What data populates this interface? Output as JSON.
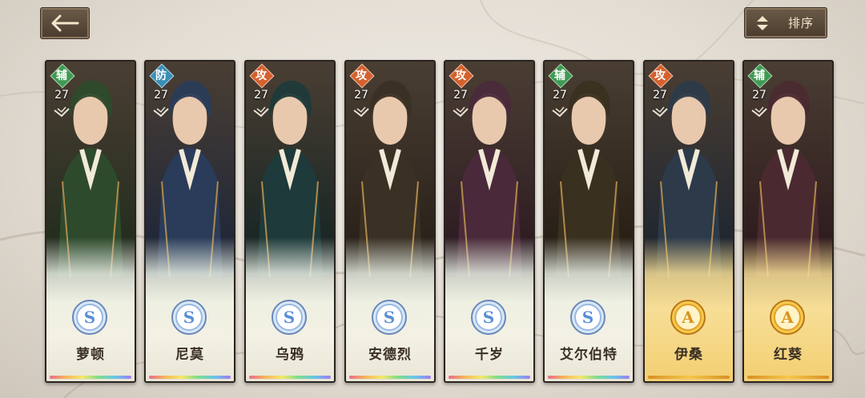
{
  "header": {
    "back_icon": "arrow-left-icon",
    "sort_icon": "sort-updown-icon",
    "sort_label": "排序"
  },
  "colors": {
    "support": "#3f9a52",
    "defense": "#3a8fb5",
    "attack": "#d4612e",
    "rank_s": "#5a8fd6",
    "rank_a": "#d9951e"
  },
  "cards": [
    {
      "role": "辅",
      "role_type": "support",
      "level": "27",
      "rank": "S",
      "name": "萝顿"
    },
    {
      "role": "防",
      "role_type": "defense",
      "level": "27",
      "rank": "S",
      "name": "尼莫"
    },
    {
      "role": "攻",
      "role_type": "attack",
      "level": "27",
      "rank": "S",
      "name": "乌鸦"
    },
    {
      "role": "攻",
      "role_type": "attack",
      "level": "27",
      "rank": "S",
      "name": "安德烈"
    },
    {
      "role": "攻",
      "role_type": "attack",
      "level": "27",
      "rank": "S",
      "name": "千岁"
    },
    {
      "role": "辅",
      "role_type": "support",
      "level": "27",
      "rank": "S",
      "name": "艾尔伯特"
    },
    {
      "role": "攻",
      "role_type": "attack",
      "level": "27",
      "rank": "A",
      "name": "伊桑"
    },
    {
      "role": "辅",
      "role_type": "support",
      "level": "27",
      "rank": "A",
      "name": "红葵"
    }
  ]
}
